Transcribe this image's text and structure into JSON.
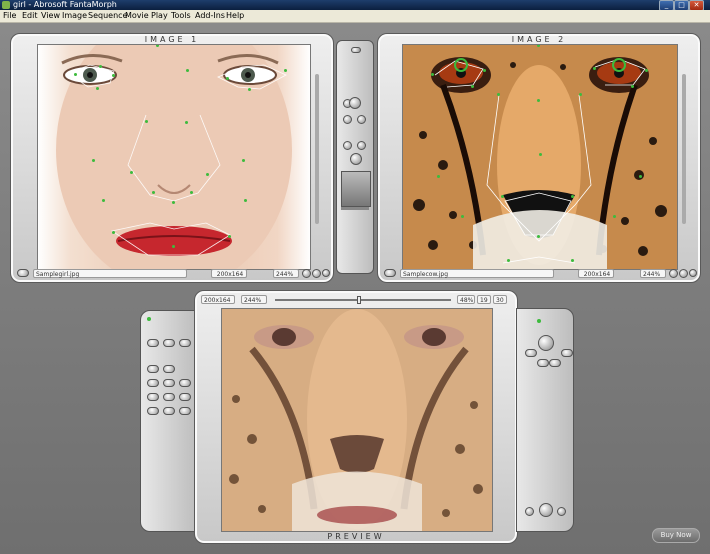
{
  "window": {
    "title": "girl - Abrosoft FantaMorph",
    "min": "_",
    "max": "□",
    "close": "✕"
  },
  "menu": [
    "File",
    "Edit",
    "View",
    "Image",
    "Sequence",
    "Movie",
    "Play",
    "Tools",
    "Add-Ins",
    "Help"
  ],
  "image1": {
    "title": "IMAGE 1",
    "filename": "Samplegirl.jpg",
    "size": "200x164",
    "zoom": "244%"
  },
  "image2": {
    "title": "IMAGE 2",
    "filename": "Samplecow.jpg",
    "size": "200x164",
    "zoom": "244%"
  },
  "preview": {
    "title": "PREVIEW",
    "size": "200x164",
    "zoom": "244%",
    "progress": "48%",
    "frame": "19",
    "total": "30",
    "progress_value": 0.48
  },
  "buy_now": "Buy Now",
  "colors": {
    "point": "#3dbb3d",
    "accent": "#1e3e6c"
  }
}
